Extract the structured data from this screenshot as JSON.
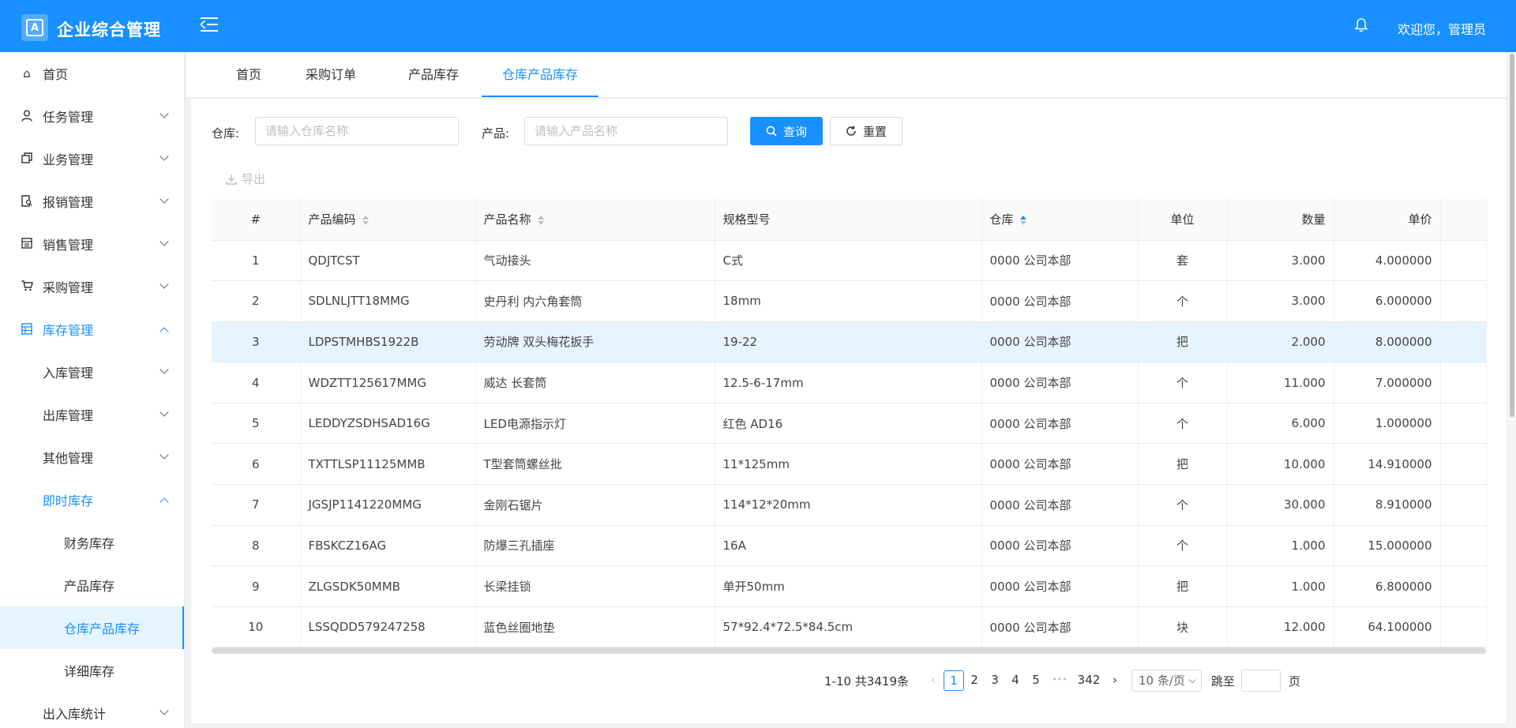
{
  "header": {
    "logo_letter": "A",
    "app_title": "企业综合管理",
    "welcome_text": "欢迎您，管理员",
    "accent_color": "#1890ff"
  },
  "sidebar": {
    "items": [
      {
        "label": "首页",
        "icon": "home-icon"
      },
      {
        "label": "任务管理",
        "icon": "user-icon"
      },
      {
        "label": "业务管理",
        "icon": "copy-icon"
      },
      {
        "label": "报销管理",
        "icon": "file-search-icon"
      },
      {
        "label": "销售管理",
        "icon": "calculator-icon"
      },
      {
        "label": "采购管理",
        "icon": "cart-icon"
      },
      {
        "label": "库存管理",
        "icon": "table-icon"
      },
      {
        "label": "入库管理"
      },
      {
        "label": "出库管理"
      },
      {
        "label": "其他管理"
      },
      {
        "label": "即时库存"
      },
      {
        "label": "财务库存"
      },
      {
        "label": "产品库存"
      },
      {
        "label": "仓库产品库存"
      },
      {
        "label": "详细库存"
      },
      {
        "label": "出入库统计"
      }
    ]
  },
  "tabs": [
    "首页",
    "采购订单",
    "产品库存",
    "仓库产品库存"
  ],
  "filters": {
    "warehouse_label": "仓库:",
    "warehouse_placeholder": "请输入仓库名称",
    "product_label": "产品:",
    "product_placeholder": "请输入产品名称",
    "query_button": "查询",
    "reset_button": "重置",
    "export_button": "导出"
  },
  "table": {
    "columns": [
      "#",
      "产品编码",
      "产品名称",
      "规格型号",
      "仓库",
      "单位",
      "数量",
      "单价"
    ],
    "rows": [
      [
        "1",
        "QDJTCST",
        "气动接头",
        "C式",
        "0000 公司本部",
        "套",
        "3.000",
        "4.000000"
      ],
      [
        "2",
        "SDLNLJTT18MMG",
        "史丹利 内六角套筒",
        "18mm",
        "0000 公司本部",
        "个",
        "3.000",
        "6.000000"
      ],
      [
        "3",
        "LDPSTMHBS1922B",
        "劳动牌 双头梅花扳手",
        "19-22",
        "0000 公司本部",
        "把",
        "2.000",
        "8.000000"
      ],
      [
        "4",
        "WDZTT125617MMG",
        "威达 长套筒",
        "12.5-6-17mm",
        "0000 公司本部",
        "个",
        "11.000",
        "7.000000"
      ],
      [
        "5",
        "LEDDYZSDHSAD16G",
        "LED电源指示灯",
        "红色 AD16",
        "0000 公司本部",
        "个",
        "6.000",
        "1.000000"
      ],
      [
        "6",
        "TXTTLSP11125MMB",
        "T型套筒螺丝批",
        "11*125mm",
        "0000 公司本部",
        "把",
        "10.000",
        "14.910000"
      ],
      [
        "7",
        "JGSJP1141220MMG",
        "金刚石锯片",
        "114*12*20mm",
        "0000 公司本部",
        "个",
        "30.000",
        "8.910000"
      ],
      [
        "8",
        "FBSKCZ16AG",
        "防爆三孔插座",
        "16A",
        "0000 公司本部",
        "个",
        "1.000",
        "15.000000"
      ],
      [
        "9",
        "ZLGSDK50MMB",
        "长梁挂锁",
        "单开50mm",
        "0000 公司本部",
        "把",
        "1.000",
        "6.800000"
      ],
      [
        "10",
        "LSSQDD579247258",
        "蓝色丝圈地垫",
        "57*92.4*72.5*84.5cm",
        "0000 公司本部",
        "块",
        "12.000",
        "64.100000"
      ]
    ],
    "highlighted_row": 3
  },
  "pagination": {
    "summary": "1-10 共3419条",
    "pages": [
      "1",
      "2",
      "3",
      "4",
      "5"
    ],
    "ellipsis": "•••",
    "last_page": "342",
    "current_page": "1",
    "page_size": "10 条/页",
    "jump_label": "跳至",
    "page_suffix": "页"
  },
  "watermark": "管理员"
}
